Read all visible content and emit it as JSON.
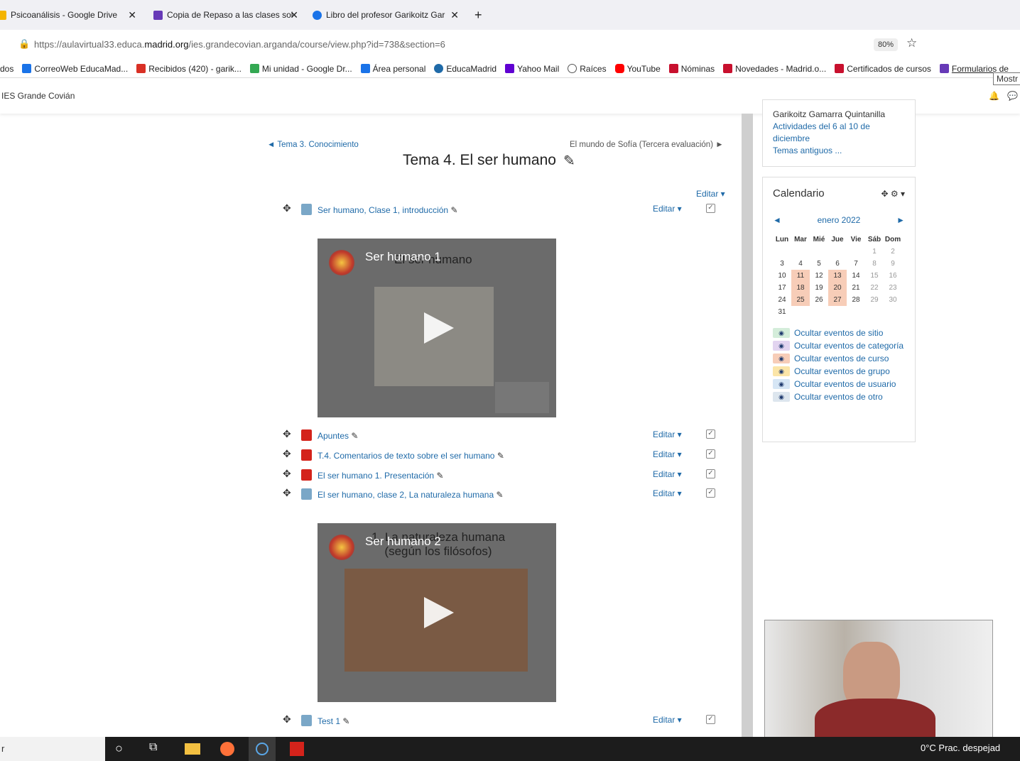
{
  "browser": {
    "tabs": [
      {
        "label": "Psicoanálisis - Google Drive",
        "color": "#f4b400"
      },
      {
        "label": "Copia de Repaso a las clases sol",
        "color": "#673ab7"
      },
      {
        "label": "Libro del profesor Garikoitz Gar",
        "color": "#1a73e8"
      }
    ],
    "new_tab": "+",
    "url_prefix": "https://aulavirtual33.educa.",
    "url_domain": "madrid.org",
    "url_suffix": "/ies.grandecovian.arganda/course/view.php?id=738&section=6",
    "zoom": "80%",
    "bookmarks": [
      {
        "label": "dos",
        "color": ""
      },
      {
        "label": "CorreoWeb EducaMad...",
        "color": "#1a73e8"
      },
      {
        "label": "Recibidos (420) - garik...",
        "color": "#d93025"
      },
      {
        "label": "Mi unidad - Google Dr...",
        "color": "#34a853"
      },
      {
        "label": "Área personal",
        "color": "#1a73e8"
      },
      {
        "label": "EducaMadrid",
        "color": "#1f6aa8"
      },
      {
        "label": "Yahoo Mail",
        "color": "#6001d2"
      },
      {
        "label": "Raíces",
        "color": "#555"
      },
      {
        "label": "YouTube",
        "color": "#ff0000"
      },
      {
        "label": "Nóminas",
        "color": "#c8102e"
      },
      {
        "label": "Novedades - Madrid.o...",
        "color": "#c8102e"
      },
      {
        "label": "Certificados de cursos",
        "color": "#c8102e"
      },
      {
        "label": "Formularios de",
        "color": "#673ab7"
      }
    ],
    "tooltip": "Mostr"
  },
  "site": {
    "name": "IES Grande Covián"
  },
  "section": {
    "prev": "◄ Tema 3. Conocimiento",
    "next": "El mundo de Sofía (Tercera evaluación) ►",
    "title": "Tema 4. El ser humano",
    "edit": "Editar ▾",
    "edit_icon": "pencil-icon",
    "items": [
      {
        "label": "Ser humano, Clase 1, introducción",
        "type": "url",
        "edit": "Editar ▾"
      },
      {
        "label": "Apuntes",
        "type": "pdf",
        "edit": "Editar ▾"
      },
      {
        "label": "T.4. Comentarios de texto sobre el ser humano",
        "type": "pdf",
        "edit": "Editar ▾"
      },
      {
        "label": "El ser humano 1. Presentación",
        "type": "pdf",
        "edit": "Editar ▾"
      },
      {
        "label": "El ser humano, clase 2, La naturaleza humana",
        "type": "url",
        "edit": "Editar ▾"
      },
      {
        "label": "Test 1",
        "type": "url",
        "edit": "Editar ▾"
      }
    ],
    "videos": [
      {
        "title": "Ser humano 1",
        "slide": "El ser humano"
      },
      {
        "title": "Ser humano 2",
        "slide": "1. La naturaleza humana (según los filósofos)"
      }
    ]
  },
  "sidebar": {
    "author": "Garikoitz Gamarra Quintanilla",
    "links": [
      "Actividades del 6 al 10 de diciembre",
      "Temas antiguos ..."
    ],
    "calendar": {
      "title": "Calendario",
      "month": "enero 2022",
      "days": [
        "Lun",
        "Mar",
        "Mié",
        "Jue",
        "Vie",
        "Sáb",
        "Dom"
      ],
      "weeks": [
        [
          "",
          "",
          "",
          "",
          "",
          "1",
          "2"
        ],
        [
          "3",
          "4",
          "5",
          "6",
          "7",
          "8",
          "9"
        ],
        [
          "10",
          "11",
          "12",
          "13",
          "14",
          "15",
          "16"
        ],
        [
          "17",
          "18",
          "19",
          "20",
          "21",
          "22",
          "23"
        ],
        [
          "24",
          "25",
          "26",
          "27",
          "28",
          "29",
          "30"
        ],
        [
          "31",
          "",
          "",
          "",
          "",
          "",
          ""
        ]
      ],
      "highlighted": [
        "11",
        "13",
        "18",
        "20",
        "25",
        "27"
      ],
      "events": [
        {
          "label": "Ocultar eventos de sitio",
          "color": "#d4edda"
        },
        {
          "label": "Ocultar eventos de categoría",
          "color": "#e2d4f0"
        },
        {
          "label": "Ocultar eventos de curso",
          "color": "#f7cdb8"
        },
        {
          "label": "Ocultar eventos de grupo",
          "color": "#fbe5a8"
        },
        {
          "label": "Ocultar eventos de usuario",
          "color": "#d6e6f5"
        },
        {
          "label": "Ocultar eventos de otro",
          "color": "#dde6ee"
        }
      ]
    }
  },
  "taskbar": {
    "search": "r",
    "weather": "0°C  Prac. despejad"
  }
}
